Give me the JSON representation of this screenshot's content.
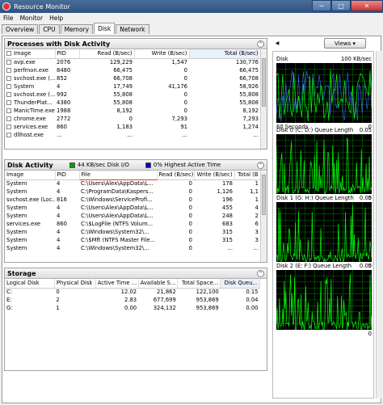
{
  "window": {
    "title": "Resource Monitor"
  },
  "menu": [
    "File",
    "Monitor",
    "Help"
  ],
  "tabs": [
    "Overview",
    "CPU",
    "Memory",
    "Disk",
    "Network"
  ],
  "active_tab": "Disk",
  "processes": {
    "title": "Processes with Disk Activity",
    "columns": [
      "Image",
      "PID",
      "Read (B/sec)",
      "Write (B/sec)",
      "Total (B/sec)"
    ],
    "rows": [
      [
        "avp.exe",
        "2076",
        "129,229",
        "1,547",
        "130,776"
      ],
      [
        "perfmon.exe",
        "8480",
        "66,475",
        "0",
        "66,475"
      ],
      [
        "svchost.exe (...",
        "852",
        "66,708",
        "0",
        "66,708"
      ],
      [
        "System",
        "4",
        "17,749",
        "41,176",
        "58,926"
      ],
      [
        "svchost.exe (...",
        "992",
        "55,808",
        "0",
        "55,808"
      ],
      [
        "ThunderPlat...",
        "4380",
        "55,808",
        "0",
        "55,808"
      ],
      [
        "ManicTime.exe",
        "1988",
        "8,192",
        "0",
        "8,192"
      ],
      [
        "chrome.exe",
        "2772",
        "0",
        "7,293",
        "7,293"
      ],
      [
        "services.exe",
        "860",
        "1,183",
        "91",
        "1,274"
      ],
      [
        "dllhost.exe",
        "...",
        "...",
        "...",
        "..."
      ]
    ]
  },
  "disk_activity": {
    "title": "Disk Activity",
    "legend_io": "44 KB/sec Disk I/O",
    "legend_active": "0% Highest Active Time",
    "columns": [
      "Image",
      "PID",
      "File",
      "Read (B/sec)",
      "Write (B/sec)",
      "Total (B"
    ],
    "rows": [
      [
        "System",
        "4",
        "C:\\Users\\Alex\\AppData\\L...",
        "0",
        "178",
        "1"
      ],
      [
        "System",
        "4",
        "C:\\ProgramData\\Kaspers...",
        "0",
        "1,126",
        "1,1"
      ],
      [
        "svchost.exe (Loc...",
        "816",
        "C:\\Windows\\ServiceProfi...",
        "0",
        "196",
        "1"
      ],
      [
        "System",
        "4",
        "C:\\Users\\Alex\\AppData\\L...",
        "0",
        "455",
        "4"
      ],
      [
        "System",
        "4",
        "C:\\Users\\Alex\\AppData\\L...",
        "0",
        "248",
        "2"
      ],
      [
        "services.exe",
        "860",
        "C:\\$LogFile (NTFS Volum...",
        "0",
        "683",
        "6"
      ],
      [
        "System",
        "4",
        "C:\\Windows\\System32\\...",
        "0",
        "315",
        "3"
      ],
      [
        "System",
        "4",
        "C:\\$Mft (NTFS Master File...",
        "0",
        "315",
        "3"
      ],
      [
        "System",
        "4",
        "C:\\Windows\\System32\\...",
        "0",
        "...",
        "..."
      ]
    ]
  },
  "storage": {
    "title": "Storage",
    "columns": [
      "Logical Disk",
      "Physical Disk",
      "Active Time ...",
      "Available S...",
      "Total Space...",
      "Disk Queu..."
    ],
    "rows": [
      [
        "C:",
        "0",
        "12.02",
        "21,862",
        "122,100",
        "0.15"
      ],
      [
        "E:",
        "2",
        "2.83",
        "677,699",
        "953,869",
        "0.04"
      ],
      [
        "G:",
        "1",
        "0.00",
        "324,132",
        "953,869",
        "0.00"
      ]
    ]
  },
  "views_button": "Views",
  "graphs": [
    {
      "label": "Disk",
      "scale": "100 KB/sec",
      "foot_left": "60 Seconds",
      "foot_right": "0"
    },
    {
      "label": "Disk 0 (C: D:) Queue Length",
      "scale": "0.05",
      "foot_left": "",
      "foot_right": "0"
    },
    {
      "label": "Disk 1 (G: H:) Queue Length",
      "scale": "0.05",
      "foot_left": "",
      "foot_right": "0"
    },
    {
      "label": "Disk 2 (E: F:) Queue Length",
      "scale": "0.05",
      "foot_left": "",
      "foot_right": "0"
    }
  ],
  "colors": {
    "graph_line": "#00ff00",
    "graph_grid": "#008000",
    "legend_io": "#00a000",
    "legend_active": "#0000cc"
  }
}
